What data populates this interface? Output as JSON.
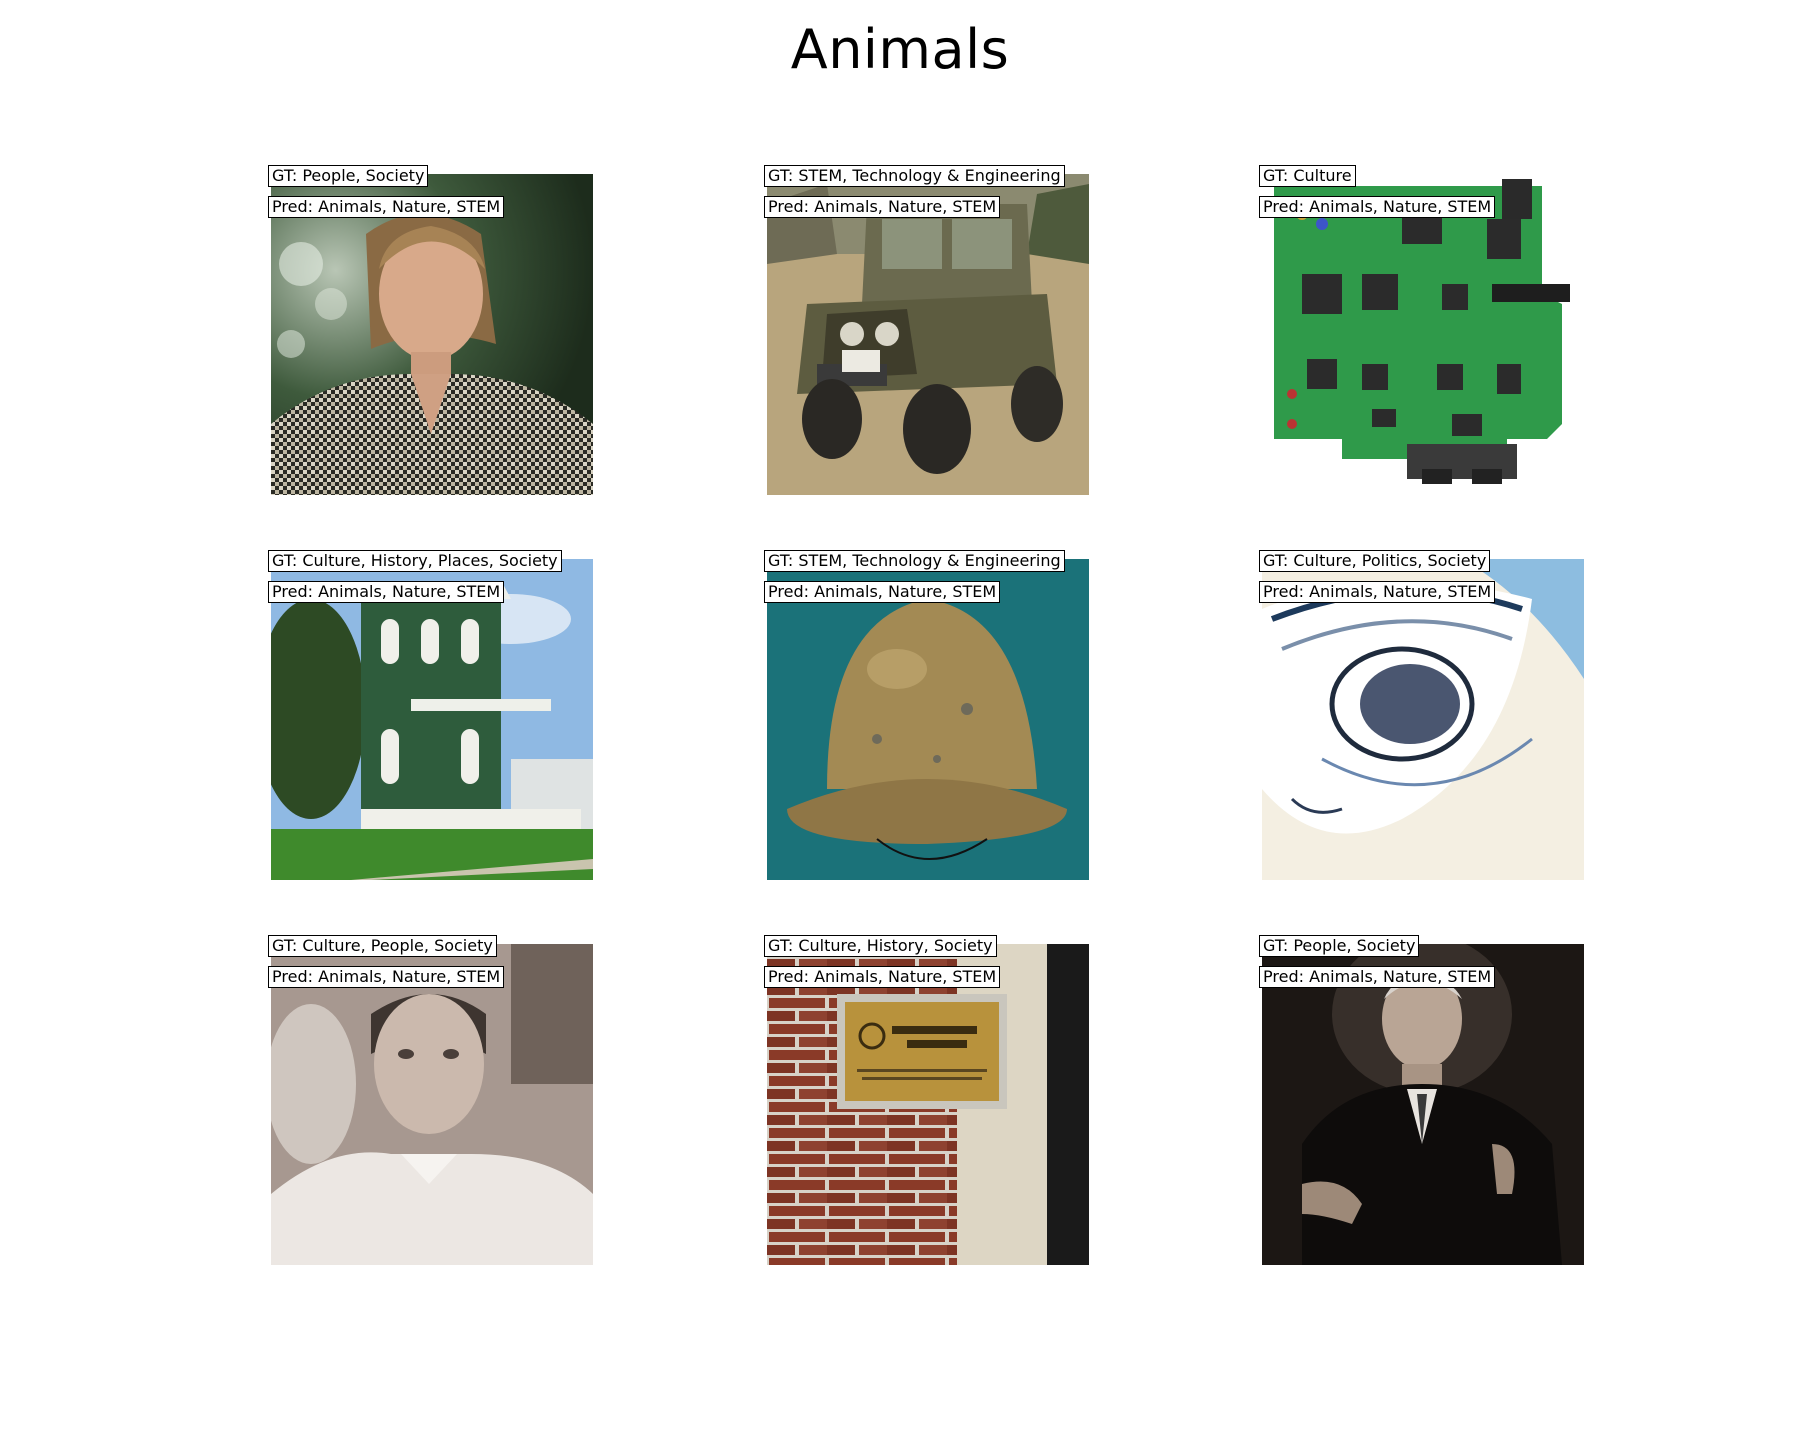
{
  "title": "Animals",
  "items": [
    {
      "gt": "GT: People, Society",
      "pred": "Pred: Animals, Nature, STEM",
      "image": "portrait-woman-patterned-blouse"
    },
    {
      "gt": "GT: STEM, Technology & Engineering",
      "pred": "Pred: Animals, Nature, STEM",
      "image": "military-jeep"
    },
    {
      "gt": "GT: Culture",
      "pred": "Pred: Animals, Nature, STEM",
      "image": "circuit-board"
    },
    {
      "gt": "GT: Culture, History, Places, Society",
      "pred": "Pred: Animals, Nature, STEM",
      "image": "green-victorian-house"
    },
    {
      "gt": "GT: STEM, Technology & Engineering",
      "pred": "Pred: Animals, Nature, STEM",
      "image": "bronze-helmet"
    },
    {
      "gt": "GT: Culture, Politics, Society",
      "pred": "Pred: Animals, Nature, STEM",
      "image": "spiral-staircase"
    },
    {
      "gt": "GT: Culture, People, Society",
      "pred": "Pred: Animals, Nature, STEM",
      "image": "vintage-portrait-man"
    },
    {
      "gt": "GT: Culture, History, Society",
      "pred": "Pred: Animals, Nature, STEM",
      "image": "engineers-ireland-plaque"
    },
    {
      "gt": "GT: People, Society",
      "pred": "Pred: Animals, Nature, STEM",
      "image": "seated-man-portrait"
    }
  ]
}
